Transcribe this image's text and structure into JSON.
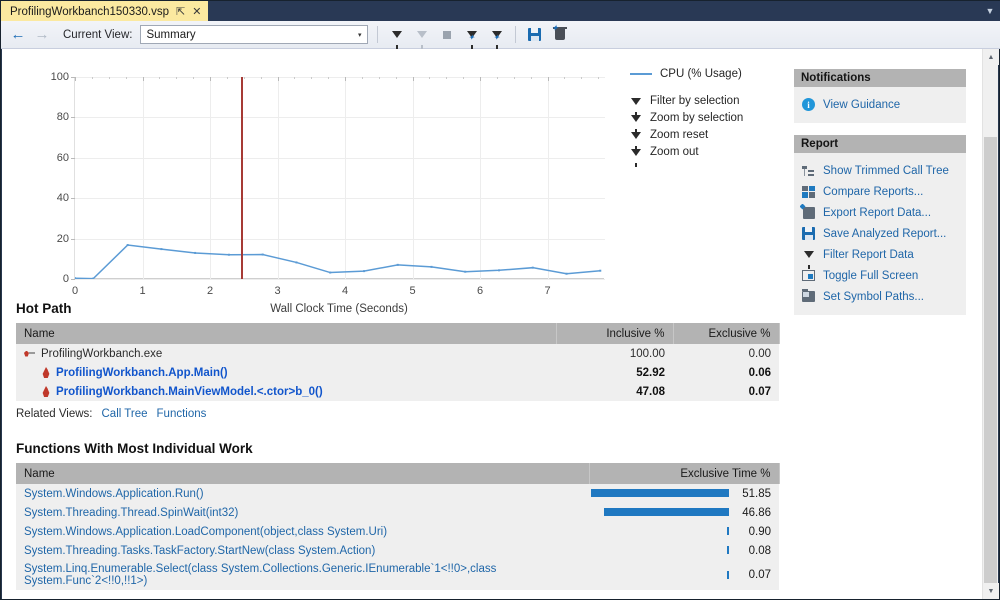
{
  "window": {
    "tab_title": "ProfilingWorkbanch150330.vsp",
    "pin_glyph": "⇱",
    "close_glyph": "✕",
    "tabstrip_chevron": "▼"
  },
  "toolbar": {
    "back_glyph": "←",
    "forward_glyph": "→",
    "current_view_label": "Current View:",
    "current_view_value": "Summary",
    "dropdown_glyph": "▾",
    "buttons": [
      {
        "name": "filter-icon",
        "label": "Filter"
      },
      {
        "name": "filter-disabled-icon",
        "label": "Filter (disabled)"
      },
      {
        "name": "stop-icon",
        "label": "Stop"
      },
      {
        "name": "zoom-by-selection-icon",
        "label": "Zoom by selection"
      },
      {
        "name": "zoom-reset-icon",
        "label": "Zoom reset"
      },
      {
        "name": "save-icon",
        "label": "Save"
      },
      {
        "name": "delete-icon",
        "label": "Delete"
      }
    ]
  },
  "chart_data": {
    "type": "line",
    "title": "",
    "xlabel": "Wall Clock Time (Seconds)",
    "ylabel": "",
    "xlim": [
      0,
      7.85
    ],
    "ylim": [
      0,
      100
    ],
    "xticks": [
      0,
      1,
      2,
      3,
      4,
      5,
      6,
      7
    ],
    "yticks": [
      0,
      20,
      40,
      60,
      80,
      100
    ],
    "grid": true,
    "legend_position": "right",
    "series": [
      {
        "name": "CPU (% Usage)",
        "color": "#5b9bd5",
        "x": [
          0.0,
          0.27,
          0.78,
          1.28,
          1.78,
          2.28,
          2.78,
          3.28,
          3.78,
          4.28,
          4.78,
          5.28,
          5.78,
          6.28,
          6.78,
          7.28,
          7.78
        ],
        "y": [
          0.4,
          0.2,
          16.8,
          14.8,
          12.9,
          12.0,
          12.1,
          8.2,
          3.2,
          3.9,
          7.0,
          6.0,
          3.6,
          4.3,
          5.6,
          2.6,
          4.1
        ]
      }
    ],
    "marker_line": {
      "x": 2.46,
      "color": "#a63a35"
    }
  },
  "chart_legend": {
    "entries": [
      {
        "label": "CPU (% Usage)",
        "color": "#5b9bd5"
      }
    ]
  },
  "chart_actions": [
    {
      "icon": "filter-by-selection-icon",
      "label": "Filter by selection"
    },
    {
      "icon": "zoom-by-selection-icon",
      "label": "Zoom by selection"
    },
    {
      "icon": "zoom-reset-icon",
      "label": "Zoom reset"
    },
    {
      "icon": "zoom-out-icon",
      "label": "Zoom out"
    }
  ],
  "notifications": {
    "title": "Notifications",
    "items": [
      {
        "icon": "info-icon",
        "label": "View Guidance"
      }
    ]
  },
  "report": {
    "title": "Report",
    "items": [
      {
        "icon": "call-tree-icon",
        "label": "Show Trimmed Call Tree"
      },
      {
        "icon": "compare-reports-icon",
        "label": "Compare Reports..."
      },
      {
        "icon": "export-icon",
        "label": "Export Report Data..."
      },
      {
        "icon": "save-icon",
        "label": "Save Analyzed Report..."
      },
      {
        "icon": "filter-icon",
        "label": "Filter Report Data"
      },
      {
        "icon": "fullscreen-icon",
        "label": "Toggle Full Screen"
      },
      {
        "icon": "symbol-paths-icon",
        "label": "Set Symbol Paths..."
      }
    ]
  },
  "hot_path": {
    "title": "Hot Path",
    "columns": [
      "Name",
      "Inclusive %",
      "Exclusive %"
    ],
    "rows": [
      {
        "icon": "exe-icon",
        "name": "ProfilingWorkbanch.exe",
        "inclusive": "100.00",
        "exclusive": "0.00",
        "level": 0,
        "link": false
      },
      {
        "icon": "flame-icon",
        "name": "ProfilingWorkbanch.App.Main()",
        "inclusive": "52.92",
        "exclusive": "0.06",
        "level": 1,
        "link": true
      },
      {
        "icon": "flame-icon",
        "name": "ProfilingWorkbanch.MainViewModel.<.ctor>b_0()",
        "inclusive": "47.08",
        "exclusive": "0.07",
        "level": 1,
        "link": true
      }
    ],
    "related_views_label": "Related Views:",
    "related_views": [
      "Call Tree",
      "Functions"
    ]
  },
  "functions": {
    "title": "Functions With Most Individual Work",
    "columns": [
      "Name",
      "Exclusive Time %"
    ],
    "max_value": 51.85,
    "rows": [
      {
        "name": "System.Windows.Application.Run()",
        "value": "51.85",
        "pct": 51.85
      },
      {
        "name": "System.Threading.Thread.SpinWait(int32)",
        "value": "46.86",
        "pct": 46.86
      },
      {
        "name": "System.Windows.Application.LoadComponent(object,class System.Uri)",
        "value": "0.90",
        "pct": 0.9
      },
      {
        "name": "System.Threading.Tasks.TaskFactory.StartNew(class System.Action)",
        "value": "0.08",
        "pct": 0.08
      },
      {
        "name": "System.Linq.Enumerable.Select(class System.Collections.Generic.IEnumerable`1<!!0>,class System.Func`2<!!0,!!1>)",
        "value": "0.07",
        "pct": 0.07
      }
    ]
  },
  "scrollbar": {
    "up_glyph": "▲",
    "down_glyph": "▼"
  }
}
